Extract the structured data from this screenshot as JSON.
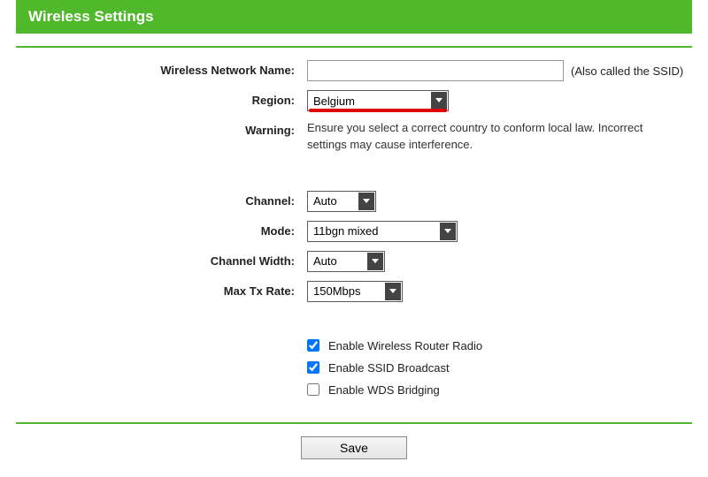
{
  "page": {
    "title": "Wireless Settings"
  },
  "fields": {
    "ssid": {
      "label": "Wireless Network Name:",
      "value": "",
      "hint": "(Also called the SSID)"
    },
    "region": {
      "label": "Region:",
      "value": "Belgium"
    },
    "warning": {
      "label": "Warning:",
      "text": "Ensure you select a correct country to conform local law. Incorrect settings may cause interference."
    },
    "channel": {
      "label": "Channel:",
      "value": "Auto"
    },
    "mode": {
      "label": "Mode:",
      "value": "11bgn mixed"
    },
    "channel_width": {
      "label": "Channel Width:",
      "value": "Auto"
    },
    "max_tx_rate": {
      "label": "Max Tx Rate:",
      "value": "150Mbps"
    }
  },
  "checkboxes": {
    "radio": {
      "label": "Enable Wireless Router Radio",
      "checked": true
    },
    "ssid_bc": {
      "label": "Enable SSID Broadcast",
      "checked": true
    },
    "wds": {
      "label": "Enable WDS Bridging",
      "checked": false
    }
  },
  "buttons": {
    "save": "Save"
  },
  "colors": {
    "accent": "#4fb92b",
    "highlight": "#e00000"
  }
}
